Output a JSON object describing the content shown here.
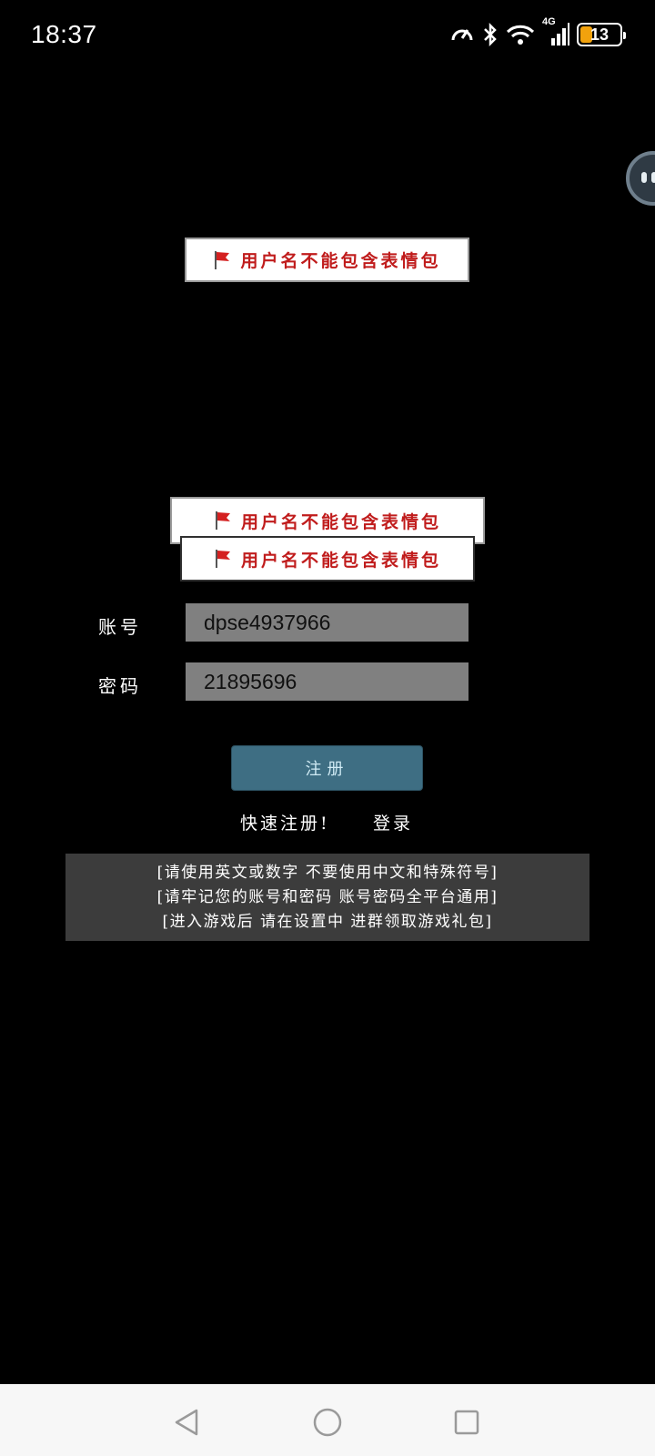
{
  "status_bar": {
    "time": "18:37",
    "network": "4G",
    "battery": "13",
    "battery_color": "#f2a20d"
  },
  "toasts": [
    {
      "text": "用户名不能包含表情包"
    },
    {
      "text": "用户名不能包含表情包"
    },
    {
      "text": "用户名不能包含表情包"
    }
  ],
  "form": {
    "account_label": "账号",
    "account_value": "dpse4937966",
    "password_label": "密码",
    "password_value": "21895696",
    "register_button": "注册"
  },
  "links": {
    "quick_register": "快速注册!",
    "login": "登录"
  },
  "notice": {
    "lines": [
      "[请使用英文或数字 不要使用中文和特殊符号]",
      "[请牢记您的账号和密码 账号密码全平台通用]",
      "[进入游戏后 请在设置中 进群领取游戏礼包]"
    ]
  },
  "colors": {
    "background": "#000000",
    "button": "#3e6e83",
    "input": "#808080",
    "toast_text": "#c01c1c",
    "notice_bg": "#3c3c3c"
  },
  "icons": {
    "status": [
      "speed-icon",
      "bluetooth-icon",
      "wifi-icon",
      "signal-icon",
      "battery-icon"
    ],
    "nav": [
      "back-icon",
      "home-icon",
      "recents-icon"
    ]
  }
}
